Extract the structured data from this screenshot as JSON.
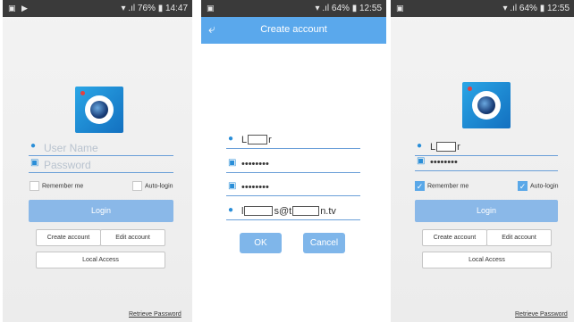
{
  "screen1": {
    "status_left": "▣ ▶",
    "status_right": "▾ .ıl 76% ▮ 14:47",
    "username_placeholder": "User Name",
    "password_placeholder": "Password",
    "remember_label": "Remember me",
    "autologin_label": "Auto-login",
    "login_label": "Login",
    "create_account_label": "Create account",
    "edit_account_label": "Edit account",
    "local_access_label": "Local Access",
    "retrieve_password_label": "Retrieve Password"
  },
  "screen2": {
    "status_left": "▣",
    "status_right": "▾ .ıl 64% ▮ 12:55",
    "title": "Create account",
    "username_prefix": "L",
    "username_suffix": "r",
    "password_value": "••••••••",
    "confirm_password_value": "••••••••",
    "email_prefix": "l",
    "email_middle": "s@t",
    "email_suffix": "n.tv",
    "ok_label": "OK",
    "cancel_label": "Cancel"
  },
  "screen3": {
    "status_left": "▣",
    "status_right": "▾ .ıl 64% ▮ 12:55",
    "username_prefix": "L",
    "username_suffix": "r",
    "password_value": "••••••••",
    "remember_label": "Remember me",
    "remember_checked": true,
    "autologin_label": "Auto-login",
    "autologin_checked": true,
    "login_label": "Login",
    "create_account_label": "Create account",
    "edit_account_label": "Edit account",
    "local_access_label": "Local Access",
    "retrieve_password_label": "Retrieve Password"
  },
  "icons": {
    "user": "user-icon",
    "lock": "lock-icon",
    "back": "back-arrow-icon",
    "check": "check-icon",
    "app": "camera-app-icon"
  },
  "colors": {
    "accent": "#5aa8ec",
    "primary_button": "#8ab8e8",
    "dialog_button": "#7fb6ea",
    "field_underline": "#6a9fd8"
  }
}
